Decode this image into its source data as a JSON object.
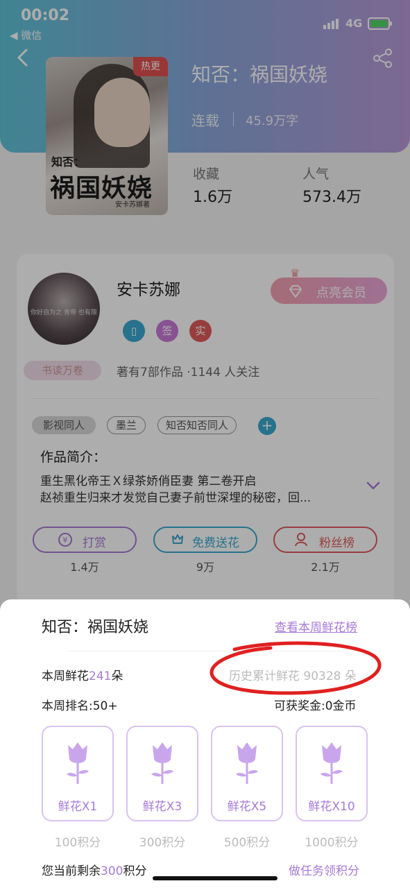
{
  "status_bar": {
    "time": "00:02",
    "back_app": "◀ 微信",
    "network": "4G"
  },
  "book": {
    "title": "知否：祸国妖娆",
    "status": "连载",
    "words": "45.9万字",
    "cover": {
      "hot_badge": "热更",
      "zhihu": "知否：",
      "title": "祸国妖娆",
      "author": "安卡苏娜著"
    },
    "stats": [
      {
        "label": "收藏",
        "value": "1.6万"
      },
      {
        "label": "人气",
        "value": "573.4万"
      }
    ]
  },
  "author": {
    "name": "安卡苏娜",
    "avatar_caption": "你好自为之 青帝 也有限",
    "vip_label": "点亮会员",
    "badges": [
      {
        "icon": "phone-icon",
        "text": "▯",
        "color": "#3aa8d0"
      },
      {
        "icon": "sign-icon",
        "text": "签",
        "color": "#c77ad8"
      },
      {
        "icon": "real-icon",
        "text": "实",
        "color": "#e05a5a"
      }
    ],
    "reading_badge": "书读万卷",
    "meta": "著有7部作品 ·1144 人关注"
  },
  "tags": [
    "影视同人",
    "墨兰",
    "知否知否同人"
  ],
  "intro": {
    "title": "作品简介：",
    "lines": [
      "重生黑化帝王Ｘ绿茶娇俏臣妻 第二卷开启",
      "赵祯重生归来才发觉自己妻子前世深埋的秘密，回..."
    ]
  },
  "actions": [
    {
      "label": "打赏",
      "count": "1.4万",
      "color": "#a77ad6"
    },
    {
      "label": "免费送花",
      "count": "9万",
      "color": "#3aa8d0"
    },
    {
      "label": "粉丝榜",
      "count": "2.1万",
      "color": "#e05a5a"
    }
  ],
  "sheet": {
    "title": "知否：祸国妖娆",
    "weekly_rank_link": "查看本周鲜花榜",
    "weekly_flowers_prefix": "本周鲜花",
    "weekly_flowers_value": "241",
    "weekly_flowers_suffix": "朵",
    "history_flowers": "历史累计鲜花 90328 朵",
    "weekly_rank": "本周排名:50+",
    "reward": "可获奖金:0金币",
    "options": [
      {
        "label": "鲜花X1",
        "points": "100积分"
      },
      {
        "label": "鲜花X3",
        "points": "300积分"
      },
      {
        "label": "鲜花X5",
        "points": "500积分"
      },
      {
        "label": "鲜花X10",
        "points": "1000积分"
      }
    ],
    "remaining_prefix": "您当前剩余",
    "remaining_value": "300",
    "remaining_suffix": "积分",
    "task_link": "做任务领积分"
  },
  "colors": {
    "accent": "#a77ad6",
    "annotation_red": "#e02020"
  }
}
